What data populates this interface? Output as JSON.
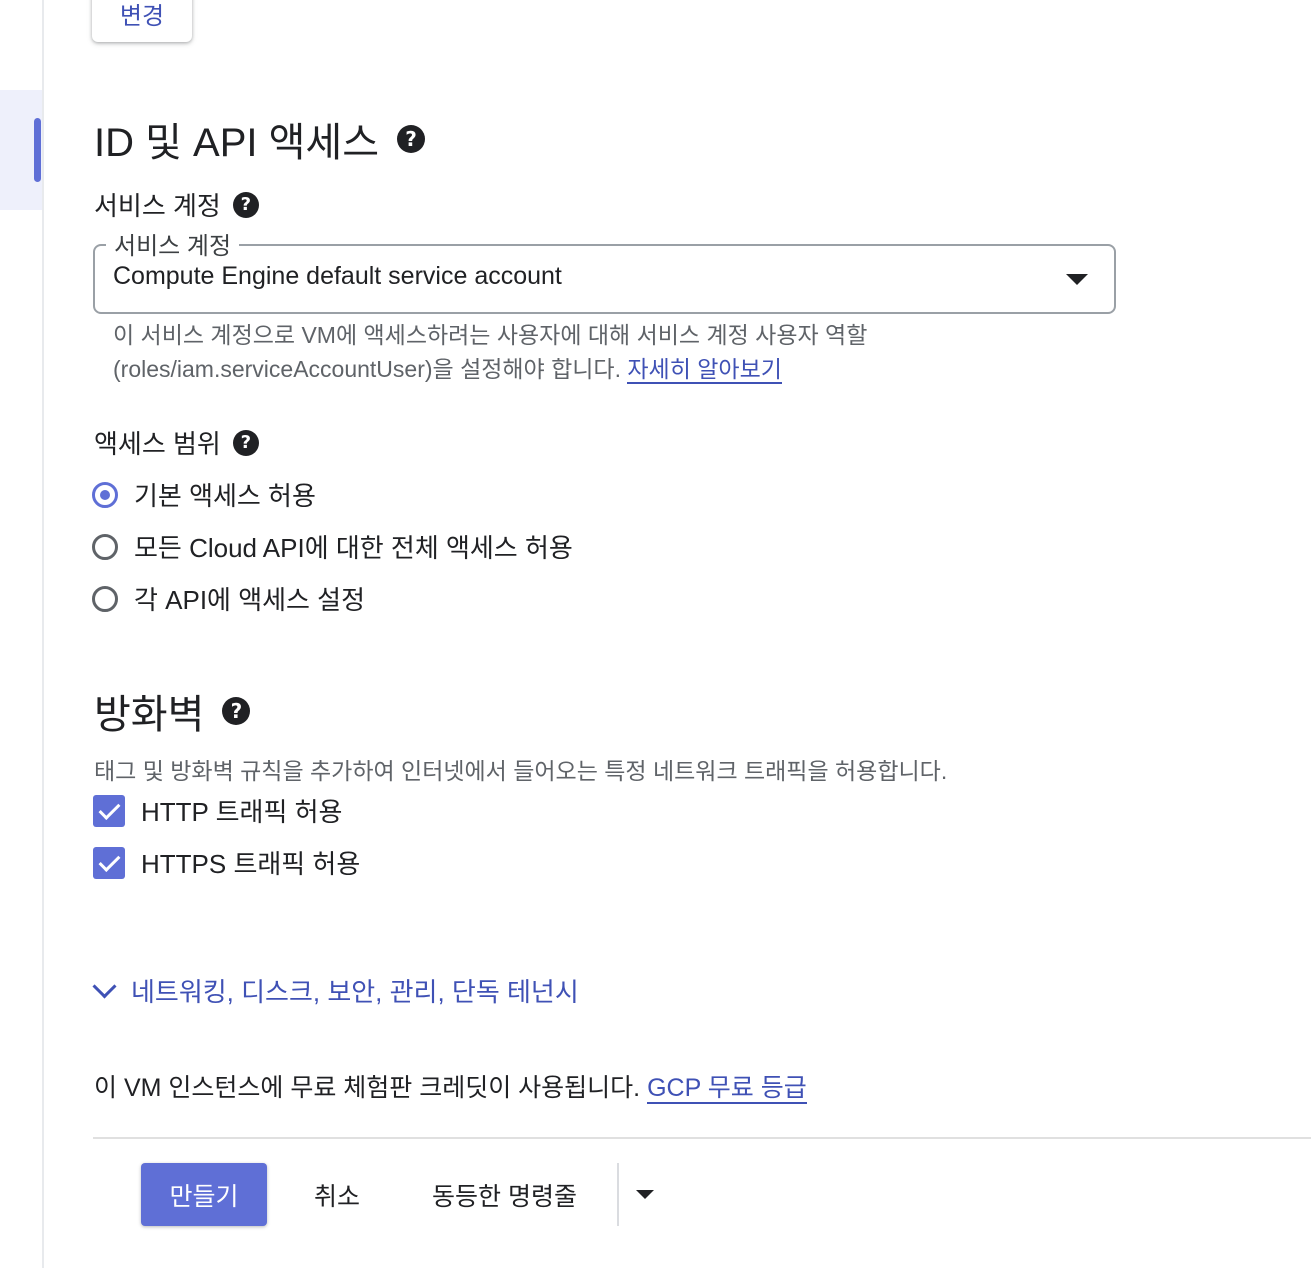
{
  "top": {
    "change_label": "변경"
  },
  "identity": {
    "title": "ID 및 API 액세스",
    "service_account_label": "서비스 계정",
    "select_legend": "서비스 계정",
    "select_value": "Compute Engine default service account",
    "helper_text": "이 서비스 계정으로 VM에 액세스하려는 사용자에 대해 서비스 계정 사용자 역할 (roles/iam.serviceAccountUser)을 설정해야 합니다. ",
    "learn_more": "자세히 알아보기",
    "scope_label": "액세스 범위",
    "scopes": [
      {
        "label": "기본 액세스 허용",
        "checked": true
      },
      {
        "label": "모든 Cloud API에 대한 전체 액세스 허용",
        "checked": false
      },
      {
        "label": "각 API에 액세스 설정",
        "checked": false
      }
    ]
  },
  "firewall": {
    "title": "방화벽",
    "description": "태그 및 방화벽 규칙을 추가하여 인터넷에서 들어오는 특정 네트워크 트래픽을 허용합니다.",
    "http_label": "HTTP 트래픽 허용",
    "https_label": "HTTPS 트래픽 허용"
  },
  "advanced": {
    "label": "네트워킹, 디스크, 보안, 관리, 단독 테넌시"
  },
  "trial": {
    "text": "이 VM 인스턴스에 무료 체험판 크레딧이 사용됩니다. ",
    "link": "GCP 무료 등급"
  },
  "footer": {
    "create_label": "만들기",
    "cancel_label": "취소",
    "command_line_label": "동등한 명령줄"
  },
  "icons": {
    "help": "?",
    "accent_color": "#5f6fd6",
    "link_color": "#3f51b5"
  }
}
